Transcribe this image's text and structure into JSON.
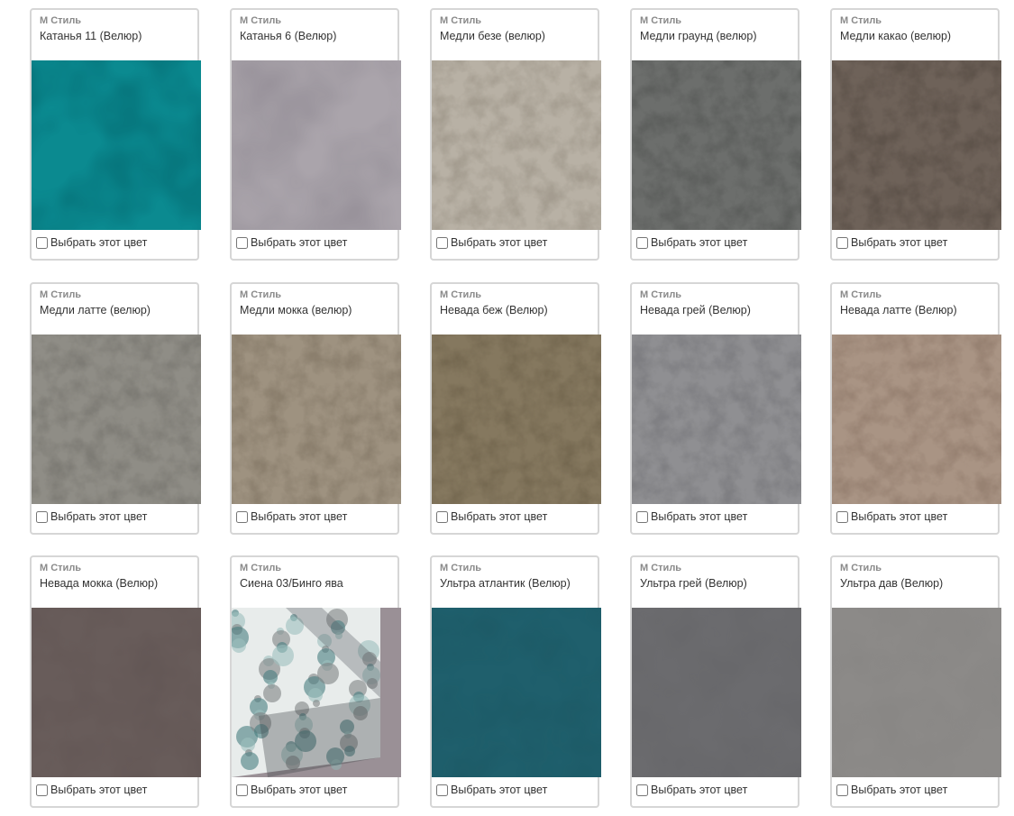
{
  "select_label": "Выбрать этот цвет",
  "fabrics": [
    {
      "brand": "М Стиль",
      "name": "Катанья 11 (Велюр)",
      "color": "#0b8a90",
      "color_dark": "#05575f",
      "pattern": "velour"
    },
    {
      "brand": "М Стиль",
      "name": "Катанья 6 (Велюр)",
      "color": "#aaa4ab",
      "color_dark": "#8f8992",
      "pattern": "velour"
    },
    {
      "brand": "М Стиль",
      "name": "Медли безе (велюр)",
      "color": "#b8b1a5",
      "color_dark": "#948c7f",
      "pattern": "suede"
    },
    {
      "brand": "М Стиль",
      "name": "Медли граунд (велюр)",
      "color": "#6c6e6c",
      "color_dark": "#505250",
      "pattern": "suede"
    },
    {
      "brand": "М Стиль",
      "name": "Медли какао (велюр)",
      "color": "#6e6259",
      "color_dark": "#51473f",
      "pattern": "suede"
    },
    {
      "brand": "М Стиль",
      "name": "Медли латте (велюр)",
      "color": "#8f8d86",
      "color_dark": "#706e68",
      "pattern": "suede"
    },
    {
      "brand": "М Стиль",
      "name": "Медли мокка (велюр)",
      "color": "#9e9280",
      "color_dark": "#7c705f",
      "pattern": "suede"
    },
    {
      "brand": "М Стиль",
      "name": "Невада беж (Велюр)",
      "color": "#85785f",
      "color_dark": "#675b44",
      "pattern": "suede"
    },
    {
      "brand": "М Стиль",
      "name": "Невада грей (Велюр)",
      "color": "#8f8f92",
      "color_dark": "#717175",
      "pattern": "suede"
    },
    {
      "brand": "М Стиль",
      "name": "Невада латте (Велюр)",
      "color": "#a99484",
      "color_dark": "#8a7465",
      "pattern": "suede"
    },
    {
      "brand": "М Стиль",
      "name": "Невада мокка (Велюр)",
      "color": "#685c5a",
      "color_dark": "#4f4443",
      "pattern": "plain"
    },
    {
      "brand": "М Стиль",
      "name": "Сиена 03/Бинго ява",
      "color": "#9a9096",
      "color_dark": "#2c6a6c",
      "pattern": "mosaic"
    },
    {
      "brand": "М Стиль",
      "name": "Ультра атлантик (Велюр)",
      "color": "#1f5f6c",
      "color_dark": "#164952",
      "pattern": "plain"
    },
    {
      "brand": "М Стиль",
      "name": "Ультра грей (Велюр)",
      "color": "#6b6b6e",
      "color_dark": "#5a5a5d",
      "pattern": "plain"
    },
    {
      "brand": "М Стиль",
      "name": "Ультра дав (Велюр)",
      "color": "#8c8a88",
      "color_dark": "#7b7977",
      "pattern": "plain"
    }
  ]
}
